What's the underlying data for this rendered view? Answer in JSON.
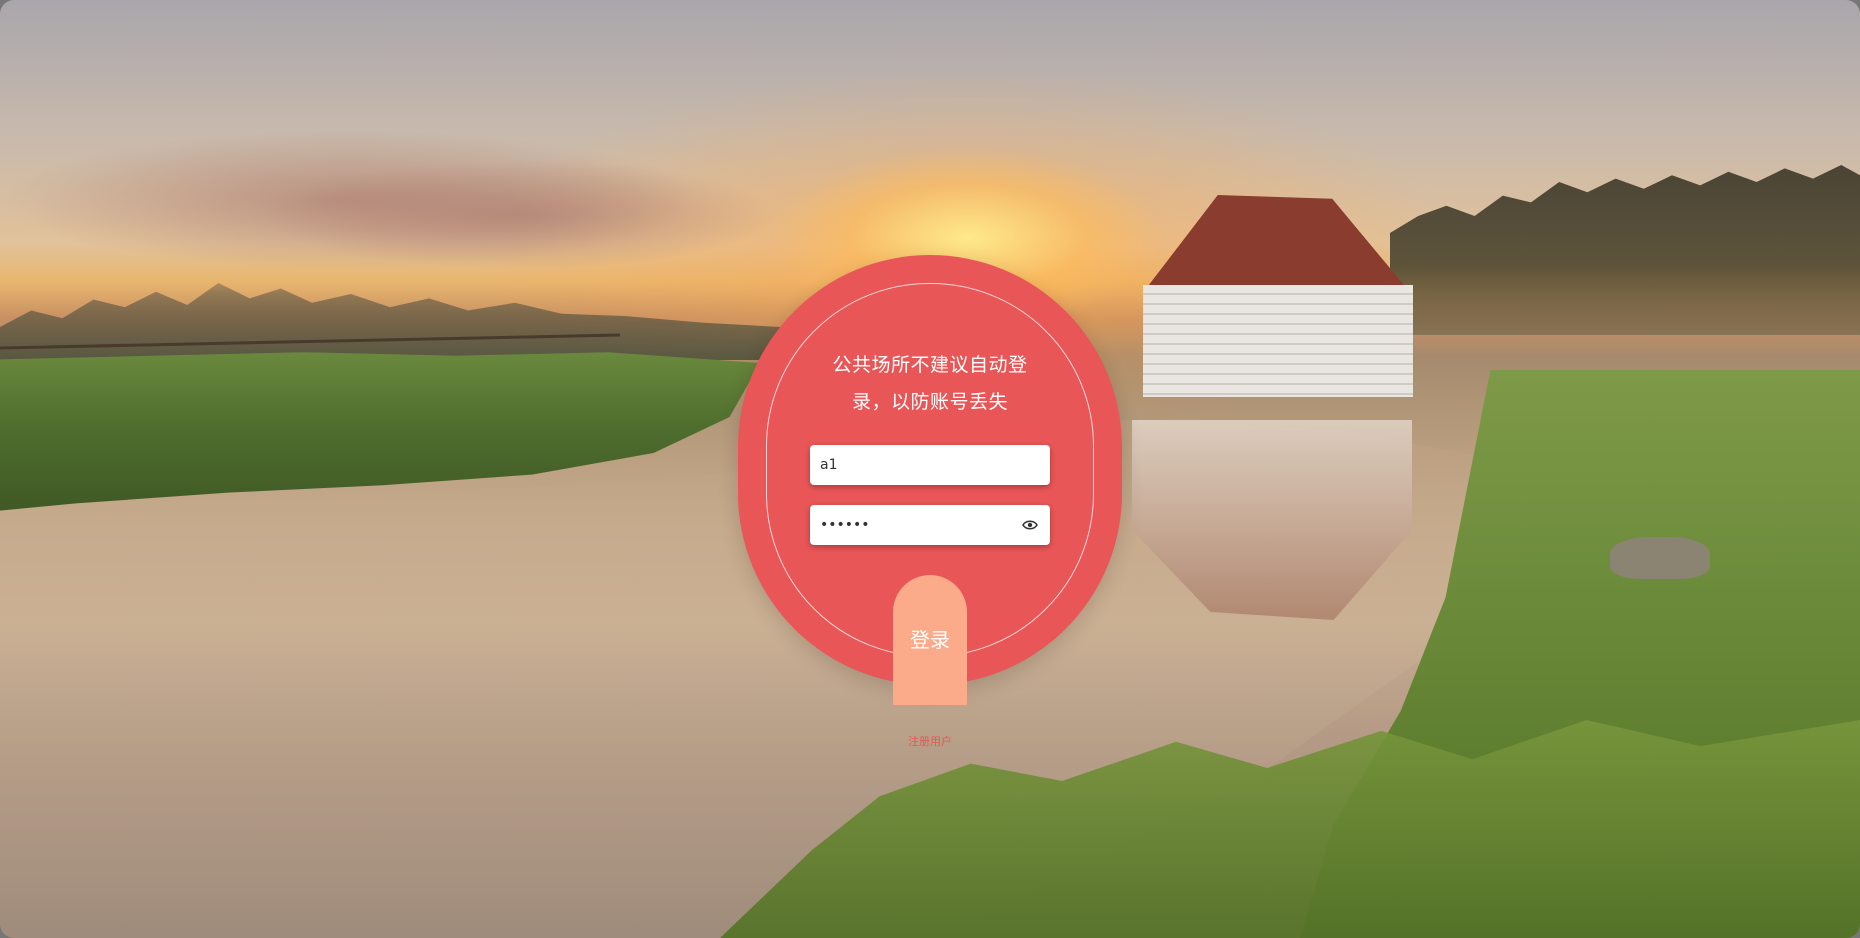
{
  "background": {
    "scene": "sunrise-river-landscape"
  },
  "login": {
    "tip": "公共场所不建议自动登录，以防账号丢失",
    "username_value": "a1",
    "password_value": "••••••",
    "toggle_icon": "eye-icon",
    "submit_label": "登录",
    "register_label": "注册用户"
  },
  "colors": {
    "card": "#e95657",
    "button": "#fbaa8a"
  }
}
